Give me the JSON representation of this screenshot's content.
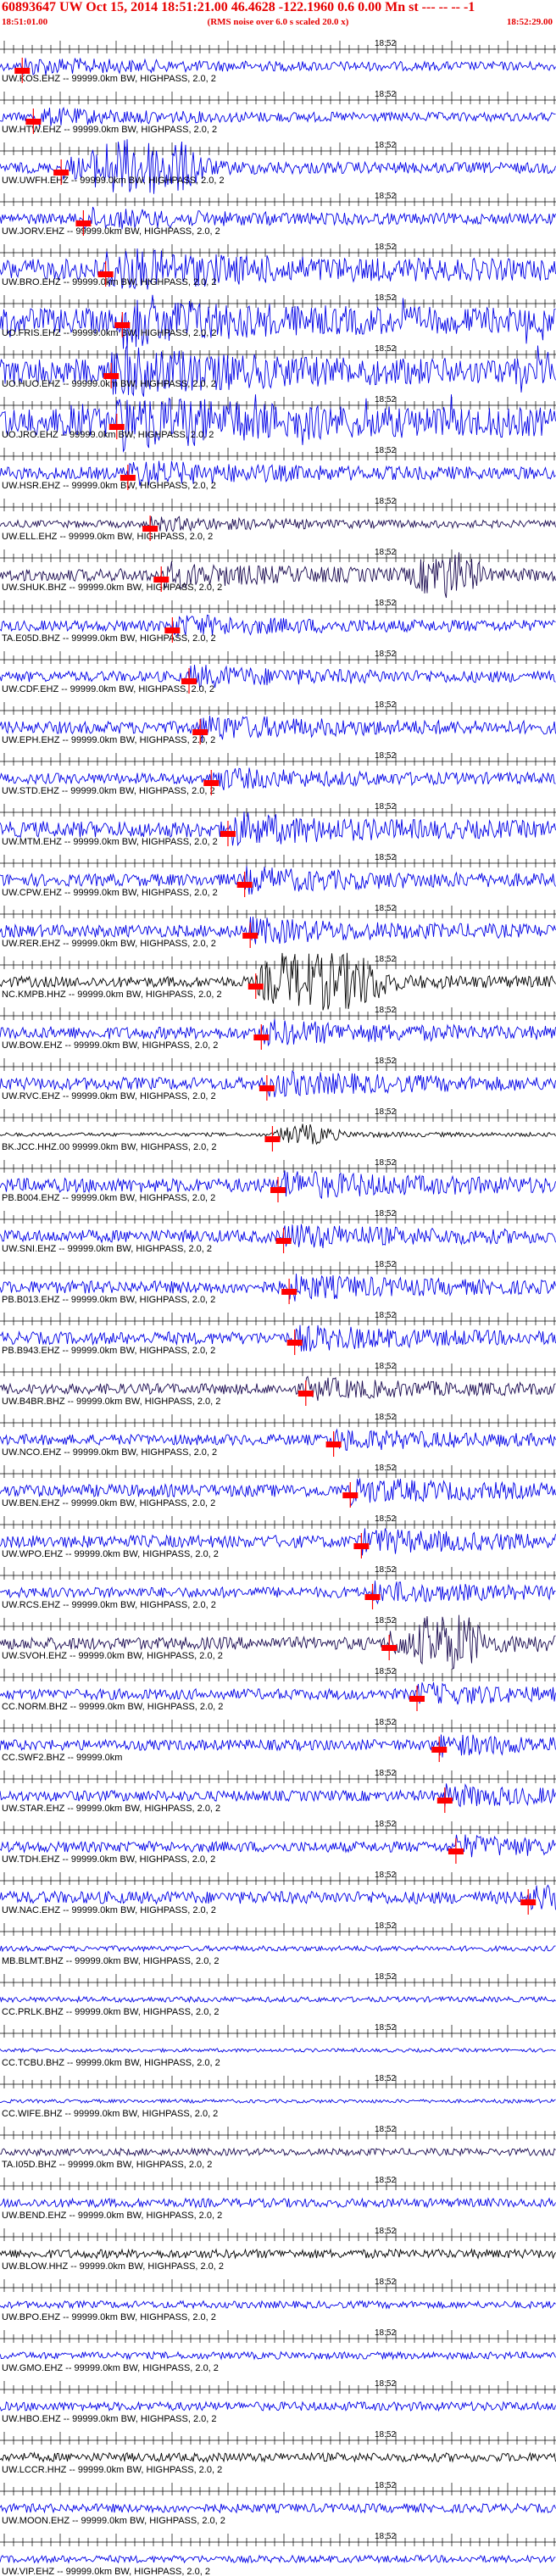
{
  "header": {
    "title": "60893647 UW Oct 15, 2014 18:51:21.00   46.4628 -122.1960  0.6 0.00 Mn st --- -- --  -1",
    "start_time": "18:51:01.00",
    "note": "(RMS noise over 6.0 s scaled 20.0 x)",
    "end_time": "18:52:29.00"
  },
  "colors": {
    "trace": "#0000e6",
    "trace_alt": "#1a0a50",
    "trace_black": "#000000",
    "pick": "#ff0000",
    "header_text": "#e60000"
  },
  "chart_data": {
    "type": "seismogram",
    "tick_label": "18:52",
    "channels": [
      {
        "label": "UW.KOS.EHZ -- 99999.0km BW, HIGHPASS, 2.0, 2",
        "color": "#0000e6",
        "amp": 0.25,
        "pick": 0.04
      },
      {
        "label": "UW.HTW.EHZ -- 99999.0km BW, HIGHPASS, 2.0, 2",
        "color": "#0000e6",
        "amp": 0.25,
        "pick": 0.06
      },
      {
        "label": "UW.UWFH.EHZ -- 99999.0km BW, HIGHPASS, 2.0, 2",
        "color": "#0000e6",
        "amp": 0.3,
        "pick": 0.11,
        "burst": [
          0.15,
          0.39,
          3.2
        ]
      },
      {
        "label": "UW.JORV.EHZ -- 99999.0km BW, HIGHPASS, 2.0, 2",
        "color": "#0000e6",
        "amp": 0.3,
        "pick": 0.15
      },
      {
        "label": "UW.BRO.EHZ -- 99999.0km BW, HIGHPASS, 2.0, 2",
        "color": "#0000e6",
        "amp": 0.6,
        "pick": 0.19
      },
      {
        "label": "UO.FRIS.EHZ -- 99999.0km BW, HIGHPASS, 2.0, 2",
        "color": "#0000e6",
        "amp": 0.7,
        "pick": 0.22,
        "spikes": true
      },
      {
        "label": "UO.HUO.EHZ -- 99999.0km BW, HIGHPASS, 2.0, 2",
        "color": "#0000e6",
        "amp": 0.7,
        "pick": 0.2,
        "spikes": true
      },
      {
        "label": "UO.JRO.EHZ -- 99999.0km BW, HIGHPASS, 2.0, 2",
        "color": "#0000e6",
        "amp": 0.8,
        "pick": 0.21,
        "spikes": true
      },
      {
        "label": "UW.HSR.EHZ -- 99999.0km BW, HIGHPASS, 2.0, 2",
        "color": "#0000e6",
        "amp": 0.35,
        "pick": 0.23
      },
      {
        "label": "UW.ELL.EHZ -- 99999.0km BW, HIGHPASS, 2.0, 2",
        "color": "#1a0a50",
        "amp": 0.2,
        "pick": 0.27
      },
      {
        "label": "UW.SHUK.BHZ -- 99999.0km BW, HIGHPASS, 2.0, 2",
        "color": "#1a0a50",
        "amp": 0.35,
        "pick": 0.29,
        "burst": [
          0.73,
          0.88,
          2.6
        ]
      },
      {
        "label": "TA.E05D.BHZ -- 99999.0km BW, HIGHPASS, 2.0, 2",
        "color": "#0000e6",
        "amp": 0.3,
        "pick": 0.31
      },
      {
        "label": "UW.CDF.EHZ -- 99999.0km BW, HIGHPASS, 2.0, 2",
        "color": "#0000e6",
        "amp": 0.3,
        "pick": 0.34
      },
      {
        "label": "UW.EPH.EHZ -- 99999.0km BW, HIGHPASS, 2.0, 2",
        "color": "#0000e6",
        "amp": 0.35,
        "pick": 0.36
      },
      {
        "label": "UW.STD.EHZ -- 99999.0km BW, HIGHPASS, 2.0, 2",
        "color": "#0000e6",
        "amp": 0.3,
        "pick": 0.38
      },
      {
        "label": "UW.MTM.EHZ -- 99999.0km BW, HIGHPASS, 2.0, 2",
        "color": "#0000e6",
        "amp": 0.45,
        "pick": 0.41
      },
      {
        "label": "UW.CPW.EHZ -- 99999.0km BW, HIGHPASS, 2.0, 2",
        "color": "#0000e6",
        "amp": 0.35,
        "pick": 0.44
      },
      {
        "label": "UW.RER.EHZ -- 99999.0km BW, HIGHPASS, 2.0, 2",
        "color": "#0000e6",
        "amp": 0.35,
        "pick": 0.45
      },
      {
        "label": "NC.KMPB.HHZ -- 99999.0km BW, HIGHPASS, 2.0, 2",
        "color": "#000000",
        "amp": 0.3,
        "pick": 0.46,
        "burst": [
          0.46,
          0.72,
          3.0
        ]
      },
      {
        "label": "UW.BOW.EHZ -- 99999.0km BW, HIGHPASS, 2.0, 2",
        "color": "#0000e6",
        "amp": 0.35,
        "pick": 0.47
      },
      {
        "label": "UW.RVC.EHZ -- 99999.0km BW, HIGHPASS, 2.0, 2",
        "color": "#0000e6",
        "amp": 0.35,
        "pick": 0.48
      },
      {
        "label": "BK.JCC.HHZ.00 99999.0km BW, HIGHPASS, 2.0, 2",
        "color": "#000000",
        "amp": 0.1,
        "pick": 0.49,
        "burst": [
          0.49,
          0.62,
          2.0
        ]
      },
      {
        "label": "PB.B004.EHZ -- 99999.0km BW, HIGHPASS, 2.0, 2",
        "color": "#0000e6",
        "amp": 0.4,
        "pick": 0.5
      },
      {
        "label": "UW.SNI.EHZ -- 99999.0km BW, HIGHPASS, 2.0, 2",
        "color": "#0000e6",
        "amp": 0.35,
        "pick": 0.51
      },
      {
        "label": "PB.B013.EHZ -- 99999.0km BW, HIGHPASS, 2.0, 2",
        "color": "#0000e6",
        "amp": 0.35,
        "pick": 0.52
      },
      {
        "label": "PB.B943.EHZ -- 99999.0km BW, HIGHPASS, 2.0, 2",
        "color": "#0000e6",
        "amp": 0.35,
        "pick": 0.53
      },
      {
        "label": "UW.B4BR.BHZ -- 99999.0km BW, HIGHPASS, 2.0, 2",
        "color": "#1a0a50",
        "amp": 0.3,
        "pick": 0.55
      },
      {
        "label": "UW.NCO.EHZ -- 99999.0km BW, HIGHPASS, 2.0, 2",
        "color": "#0000e6",
        "amp": 0.3,
        "pick": 0.6
      },
      {
        "label": "UW.BEN.EHZ -- 99999.0km BW, HIGHPASS, 2.0, 2",
        "color": "#0000e6",
        "amp": 0.35,
        "pick": 0.63
      },
      {
        "label": "UW.WPO.EHZ -- 99999.0km BW, HIGHPASS, 2.0, 2",
        "color": "#0000e6",
        "amp": 0.35,
        "pick": 0.65
      },
      {
        "label": "UW.RCS.EHZ -- 99999.0km BW, HIGHPASS, 2.0, 2",
        "color": "#0000e6",
        "amp": 0.3,
        "pick": 0.67
      },
      {
        "label": "UW.SVOH.EHZ -- 99999.0km BW, HIGHPASS, 2.0, 2",
        "color": "#1a0a50",
        "amp": 0.35,
        "pick": 0.7,
        "burst": [
          0.74,
          0.88,
          2.2
        ]
      },
      {
        "label": "CC.NORM.BHZ -- 99999.0km BW, HIGHPASS, 2.0, 2",
        "color": "#0000e6",
        "amp": 0.3,
        "pick": 0.75
      },
      {
        "label": "CC.SWF2.BHZ -- 99999.0km",
        "color": "#0000e6",
        "amp": 0.3,
        "pick": 0.79
      },
      {
        "label": "UW.STAR.EHZ -- 99999.0km BW, HIGHPASS, 2.0, 2",
        "color": "#0000e6",
        "amp": 0.3,
        "pick": 0.8
      },
      {
        "label": "UW.TDH.EHZ -- 99999.0km BW, HIGHPASS, 2.0, 2",
        "color": "#0000e6",
        "amp": 0.3,
        "pick": 0.82
      },
      {
        "label": "UW.NAC.EHZ -- 99999.0km BW, HIGHPASS, 2.0, 2",
        "color": "#0000e6",
        "amp": 0.35,
        "pick": 0.95
      },
      {
        "label": "MB.BLMT.BHZ -- 99999.0km BW, HIGHPASS, 2.0, 2",
        "color": "#0000e6",
        "amp": 0.15
      },
      {
        "label": "CC.PRLK.BHZ -- 99999.0km BW, HIGHPASS, 2.0, 2",
        "color": "#0000e6",
        "amp": 0.15
      },
      {
        "label": "CC.TCBU.BHZ -- 99999.0km BW, HIGHPASS, 2.0, 2",
        "color": "#0000e6",
        "amp": 0.1
      },
      {
        "label": "CC.WIFE.BHZ -- 99999.0km BW, HIGHPASS, 2.0, 2",
        "color": "#0000e6",
        "amp": 0.1
      },
      {
        "label": "TA.I05D.BHZ -- 99999.0km BW, HIGHPASS, 2.0, 2",
        "color": "#1a0a50",
        "amp": 0.2
      },
      {
        "label": "UW.BEND.EHZ -- 99999.0km BW, HIGHPASS, 2.0, 2",
        "color": "#0000e6",
        "amp": 0.25
      },
      {
        "label": "UW.BLOW.HHZ -- 99999.0km BW, HIGHPASS, 2.0, 2",
        "color": "#000000",
        "amp": 0.25
      },
      {
        "label": "UW.BPO.EHZ -- 99999.0km BW, HIGHPASS, 2.0, 2",
        "color": "#0000e6",
        "amp": 0.2
      },
      {
        "label": "UW.GMO.EHZ -- 99999.0km BW, HIGHPASS, 2.0, 2",
        "color": "#0000e6",
        "amp": 0.2
      },
      {
        "label": "UW.HBO.EHZ -- 99999.0km BW, HIGHPASS, 2.0, 2",
        "color": "#0000e6",
        "amp": 0.25
      },
      {
        "label": "UW.LCCR.HHZ -- 99999.0km BW, HIGHPASS, 2.0, 2",
        "color": "#000000",
        "amp": 0.25
      },
      {
        "label": "UW.MOON.EHZ -- 99999.0km BW, HIGHPASS, 2.0, 2",
        "color": "#0000e6",
        "amp": 0.25
      },
      {
        "label": "UW.VIP.EHZ -- 99999.0km BW, HIGHPASS, 2.0, 2",
        "color": "#0000e6",
        "amp": 0.2
      }
    ]
  }
}
